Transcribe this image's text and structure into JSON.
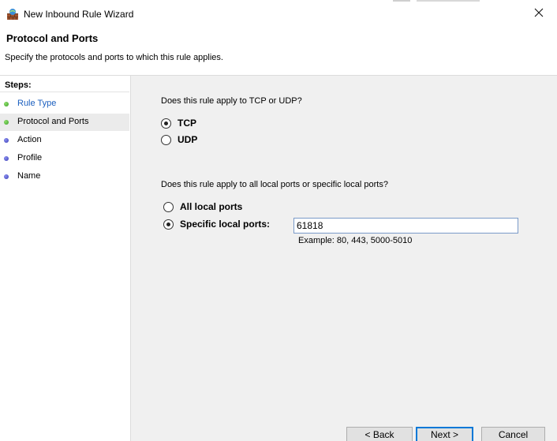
{
  "window": {
    "title": "New Inbound Rule Wizard"
  },
  "header": {
    "title": "Protocol and Ports",
    "description": "Specify the protocols and ports to which this rule applies."
  },
  "steps": {
    "title": "Steps:",
    "items": [
      {
        "label": "Rule Type",
        "state": "done"
      },
      {
        "label": "Protocol and Ports",
        "state": "current"
      },
      {
        "label": "Action",
        "state": "todo"
      },
      {
        "label": "Profile",
        "state": "todo"
      },
      {
        "label": "Name",
        "state": "todo"
      }
    ]
  },
  "protocol": {
    "question": "Does this rule apply to TCP or UDP?",
    "options": [
      "TCP",
      "UDP"
    ],
    "selected": "TCP"
  },
  "ports": {
    "question": "Does this rule apply to all local ports or specific local ports?",
    "all_label": "All local ports",
    "specific_label": "Specific local ports:",
    "selected": "Specific local ports:",
    "value": "61818",
    "example": "Example: 80, 443, 5000-5010"
  },
  "buttons": {
    "back": "< Back",
    "next": "Next >",
    "cancel": "Cancel"
  },
  "colors": {
    "step_done": "#3c9d2a",
    "step_todo": "#3b3fb5",
    "link": "#1b5fbf",
    "content_bg": "#f0f0f0",
    "default_button_border": "#0078d7"
  },
  "icons": {
    "app": "firewall-wall-icon",
    "close": "close-icon"
  }
}
